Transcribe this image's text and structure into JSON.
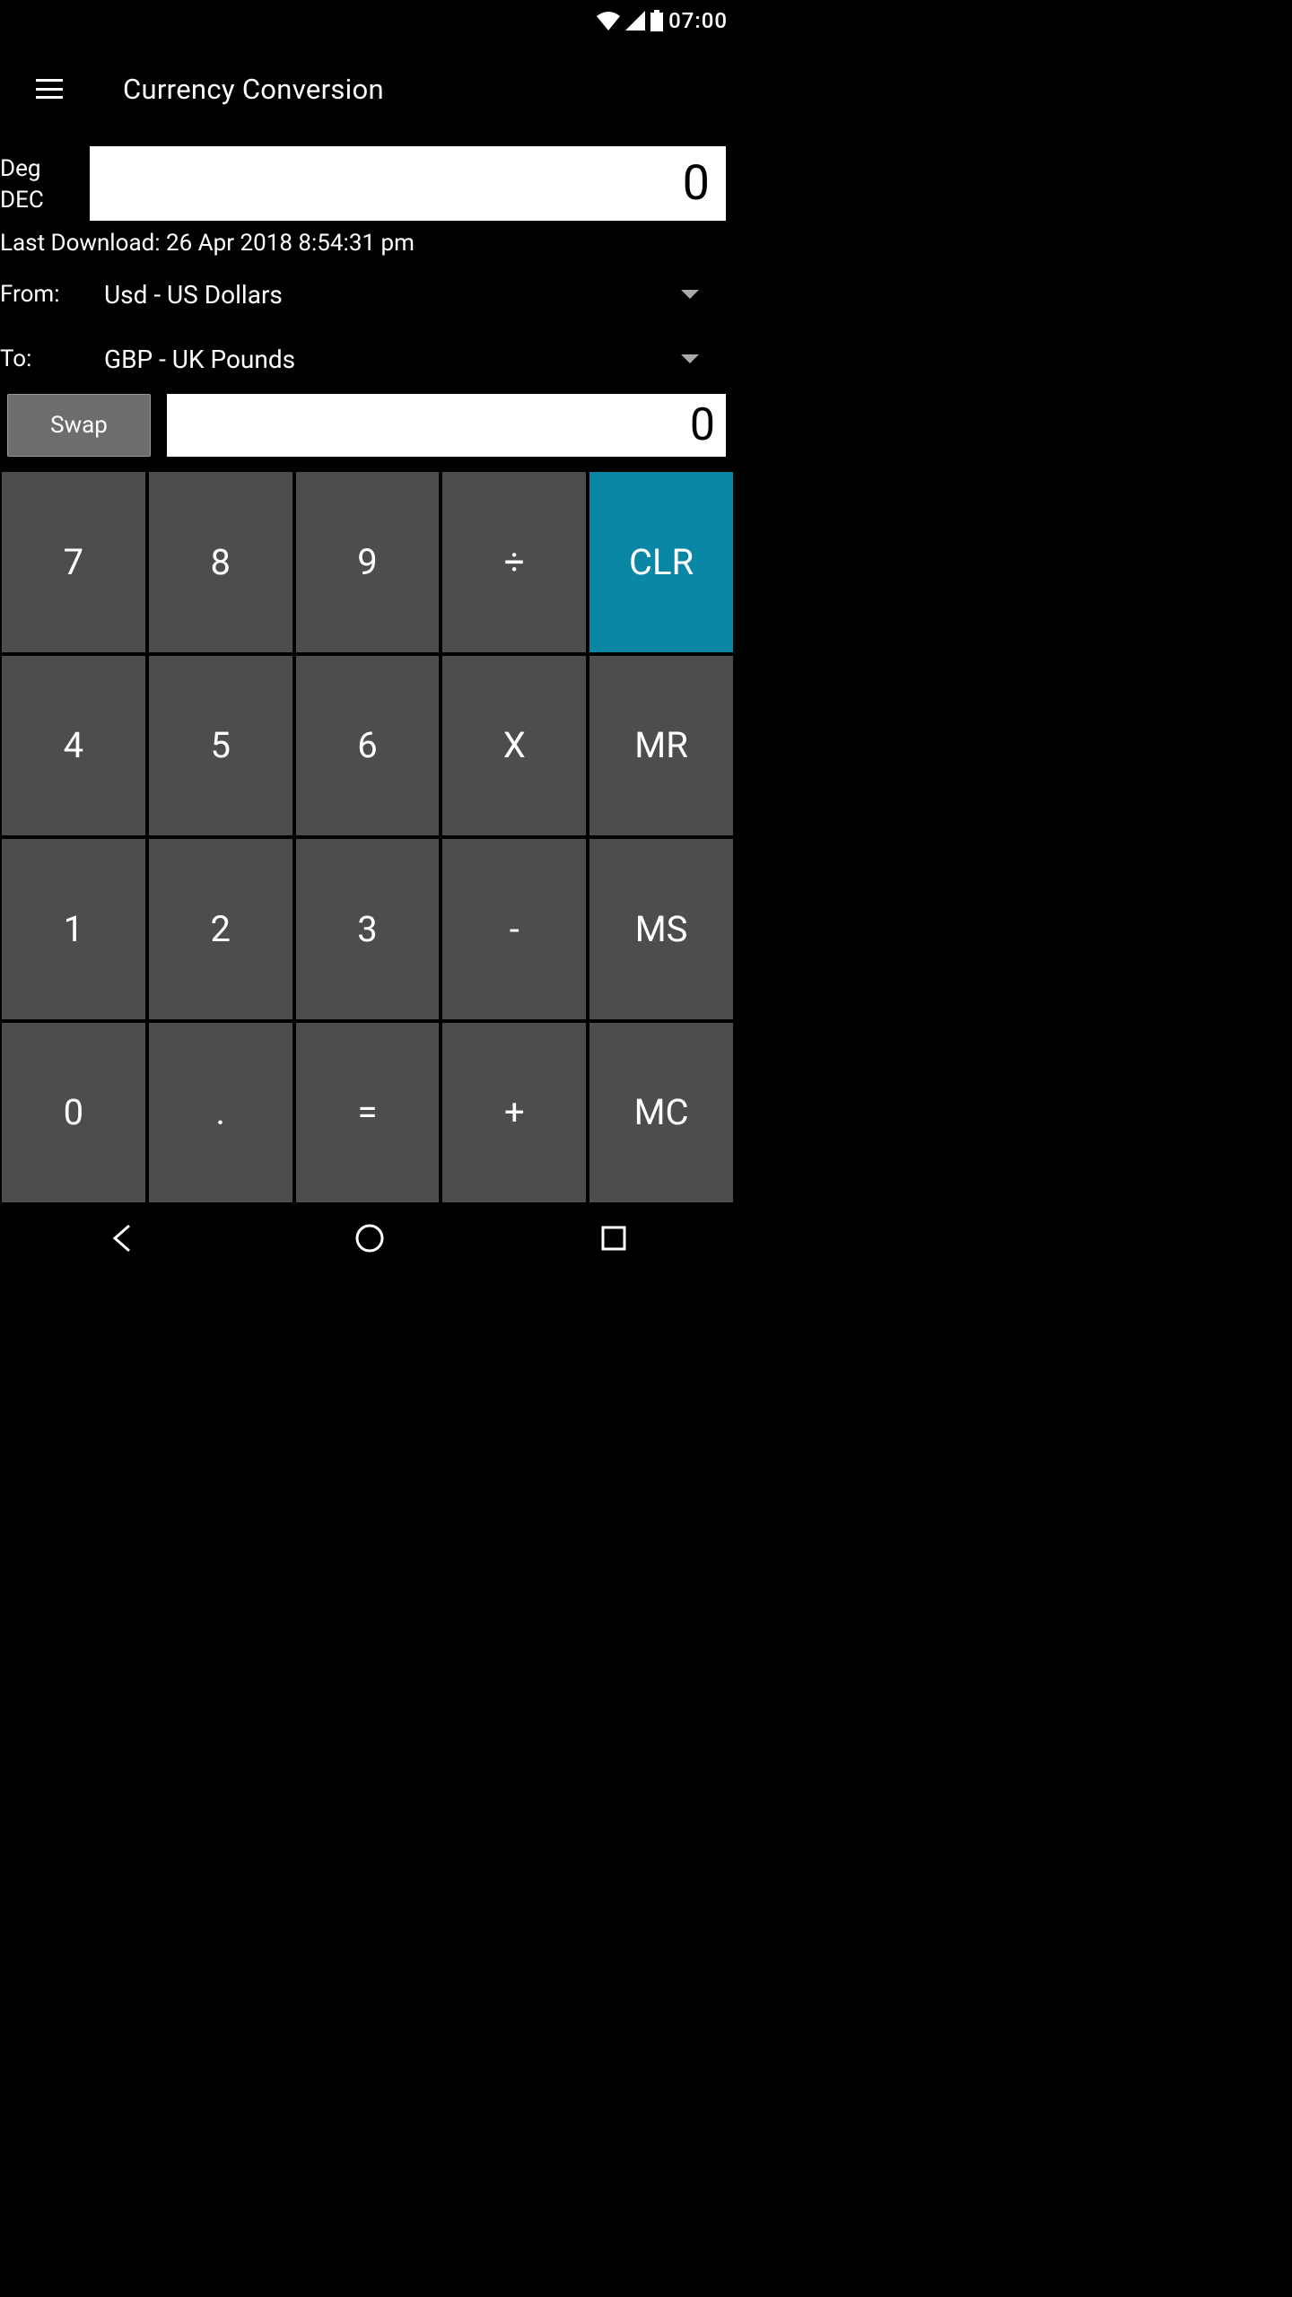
{
  "statusbar": {
    "time": "07:00"
  },
  "appbar": {
    "title": "Currency Conversion"
  },
  "mode": {
    "line1": "Deg",
    "line2": "DEC"
  },
  "display": {
    "value": "0"
  },
  "last_download": "Last Download: 26 Apr 2018 8:54:31 pm",
  "from": {
    "label": "From:",
    "value": "Usd - US Dollars"
  },
  "to": {
    "label": "To:",
    "value": "GBP - UK Pounds"
  },
  "swap": {
    "label": "Swap"
  },
  "result": {
    "value": "0"
  },
  "keys": {
    "k7": "7",
    "k8": "8",
    "k9": "9",
    "kdiv": "÷",
    "kclr": "CLR",
    "k4": "4",
    "k5": "5",
    "k6": "6",
    "kmul": "X",
    "kmr": "MR",
    "k1": "1",
    "k2": "2",
    "k3": "3",
    "ksub": "-",
    "kms": "MS",
    "k0": "0",
    "kdot": ".",
    "keq": "=",
    "kadd": "+",
    "kmc": "MC"
  }
}
